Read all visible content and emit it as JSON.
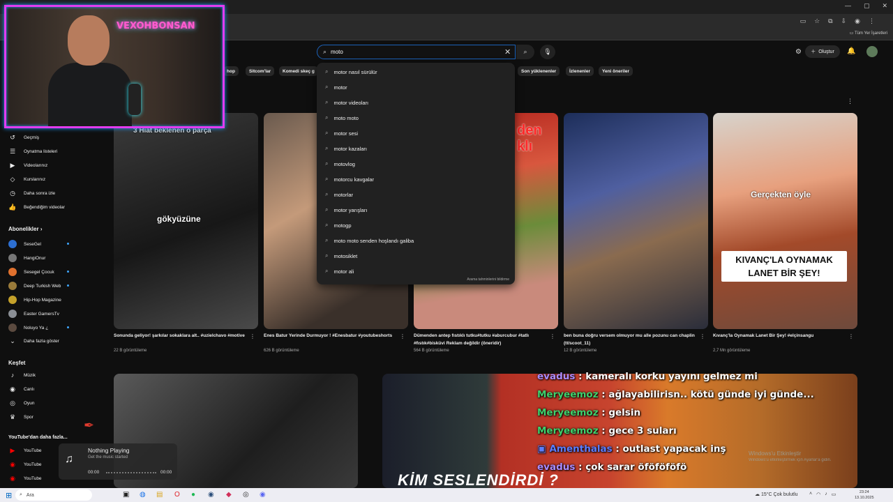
{
  "search": {
    "value": "moto"
  },
  "header": {
    "create_label": "Oluştur",
    "bookmarks_label": "Tüm Yer İşaretleri"
  },
  "chips": [
    "hop",
    "Sitcom'lar",
    "Komedi skeç g",
    "Son yüklenenler",
    "İzlenenler",
    "Yeni öneriler"
  ],
  "suggestions": [
    "motor nasıl sürülür",
    "motor",
    "motor videoları",
    "moto moto",
    "motor sesi",
    "motor kazaları",
    "motovlog",
    "motorcu kavgalar",
    "motorlar",
    "motor yarışları",
    "motogp",
    "moto moto senden hoşlandı galiba",
    "motosiklet",
    "motor ali"
  ],
  "suggestions_report": "Arama tahminlerini bildirme",
  "sidebar": {
    "items": [
      "Geçmiş",
      "Oynatma listeleri",
      "Videolarınız",
      "Kurslarınız",
      "Daha sonra izle",
      "Beğendiğim videolar"
    ],
    "subs_heading": "Abonelikler",
    "subs": [
      "SeseGel",
      "HangiOnur",
      "Sesegel Çocuk",
      "Deep Turkish Web",
      "Hip-Hop Magazine",
      "Easter GamersTv",
      "Noluyo Ya ¿"
    ],
    "more_label": "Daha fazla göster",
    "explore_heading": "Keşfet",
    "explore": [
      "Müzik",
      "Canlı",
      "Oyun",
      "Spor"
    ],
    "more_heading": "YouTube'dan daha fazla...",
    "yt_items": [
      "YouTube",
      "YouTube",
      "YouTube"
    ]
  },
  "webcam": {
    "neon": "VEXOHBONSAN"
  },
  "videos": [
    {
      "overlay": "gökyüzüne",
      "top_text": "3 Hiat beklenen o parça",
      "title": "Sonunda geliyor! şarkılar sokaklara alt.. #uzielchavo #motive",
      "views": "22 B görüntüleme"
    },
    {
      "overlay": "",
      "top_text": "",
      "title": "Enes Batur Yerinde Durmuyor ! #Enesbatur #youtubeshorts",
      "views": "626 B görüntüleme"
    },
    {
      "overlay": "den klı",
      "top_text": "",
      "title": "Dümenden antep fıstıklı tutku#tutku #aburcubur #tatlı #fıstık#bisküvi Reklam  değildir (öneridir)",
      "views": "564 B görüntüleme"
    },
    {
      "overlay": "",
      "top_text": "",
      "title": "ben buna doğru versem olmuyor mu alle pozunu can chaplin (tt/scoot_11)",
      "views": "12 B görüntüleme"
    },
    {
      "overlay": "Gerçekten öyle",
      "top_text": "KIVANÇ'LA OYNAMAK LANET BİR ŞEY!",
      "title": "Kıvanç'la Oynamak Lanet Bir Şey! #elçinsangu",
      "views": "2,7 Mn görüntüleme"
    }
  ],
  "chat": [
    {
      "user": "evadus",
      "msg": " : kameralı korku yayını gelmez mi"
    },
    {
      "user": "Meryeemoz",
      "msg": " : ağlayabilirisn.. kötü günde iyi günde..."
    },
    {
      "user": "Meryeemoz",
      "msg": " : gelsin"
    },
    {
      "user": "Meryeemoz",
      "msg": " : gece 3 suları"
    },
    {
      "user": "Amenthalas",
      "msg": " : outlast yapacak inş"
    },
    {
      "user": "evadus",
      "msg": " : çok sarar öföföföfö"
    }
  ],
  "bottom_caption": "KİM SESLENDİRDİ ?",
  "music": {
    "title": "Nothing Playing",
    "subtitle": "Get the music started",
    "time_start": "00:00",
    "time_end": "00:00"
  },
  "watermark": {
    "line1": "Windows'u Etkinleştir",
    "line2": "Windows'u etkinleştirmek için Ayarlar'a gidin."
  },
  "taskbar": {
    "search_label": "Ara",
    "weather": "15°C  Çok bulutlu",
    "time": "23:24",
    "date": "13.10.2025"
  }
}
